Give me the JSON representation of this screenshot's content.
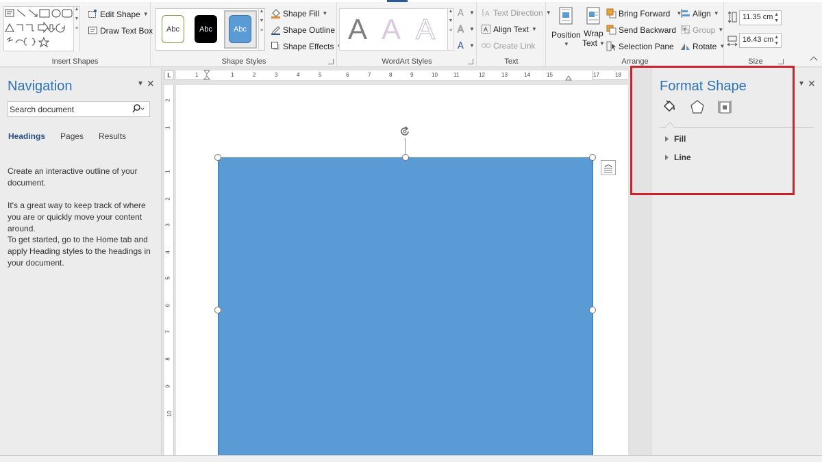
{
  "ribbon": {
    "insert_shapes": {
      "label": "Insert Shapes",
      "edit_shape": "Edit Shape",
      "draw_text_box": "Draw Text Box"
    },
    "shape_styles": {
      "label": "Shape Styles",
      "swatches": [
        "Abc",
        "Abc",
        "Abc"
      ],
      "shape_fill": "Shape Fill",
      "shape_outline": "Shape Outline",
      "shape_effects": "Shape Effects"
    },
    "wordart_styles": {
      "label": "WordArt Styles",
      "letters": [
        "A",
        "A",
        "A"
      ]
    },
    "text": {
      "label": "Text",
      "text_direction": "Text Direction",
      "align_text": "Align Text",
      "create_link": "Create Link"
    },
    "arrange": {
      "label": "Arrange",
      "position": "Position",
      "wrap_text_1": "Wrap",
      "wrap_text_2": "Text",
      "bring_forward": "Bring Forward",
      "send_backward": "Send Backward",
      "selection_pane": "Selection Pane",
      "align": "Align",
      "group": "Group",
      "rotate": "Rotate"
    },
    "size": {
      "label": "Size",
      "height": "11.35 cm",
      "width": "16.43 cm"
    }
  },
  "navigation": {
    "title": "Navigation",
    "search_placeholder": "Search document",
    "tabs": [
      "Headings",
      "Pages",
      "Results"
    ],
    "paragraphs": [
      "Create an interactive outline of your document.",
      "It's a great way to keep track of where you are or quickly move your content around.",
      "To get started, go to the Home tab and apply Heading styles to the headings in your document."
    ]
  },
  "ruler": {
    "corner": "L",
    "h_numbers": [
      "1",
      "1",
      "2",
      "3",
      "4",
      "5",
      "6",
      "7",
      "8",
      "9",
      "10",
      "11",
      "12",
      "13",
      "14",
      "15",
      "17",
      "18"
    ],
    "v_numbers": [
      "2",
      "1",
      "1",
      "2",
      "3",
      "4",
      "5",
      "6",
      "7",
      "8",
      "9",
      "10"
    ]
  },
  "format_shape": {
    "title": "Format Shape",
    "sections": [
      "Fill",
      "Line"
    ]
  },
  "colors": {
    "accent": "#2e73b8",
    "shape_fill": "#5b9bd5",
    "shape_outline": "#41719c",
    "highlight": "#d0202d"
  }
}
